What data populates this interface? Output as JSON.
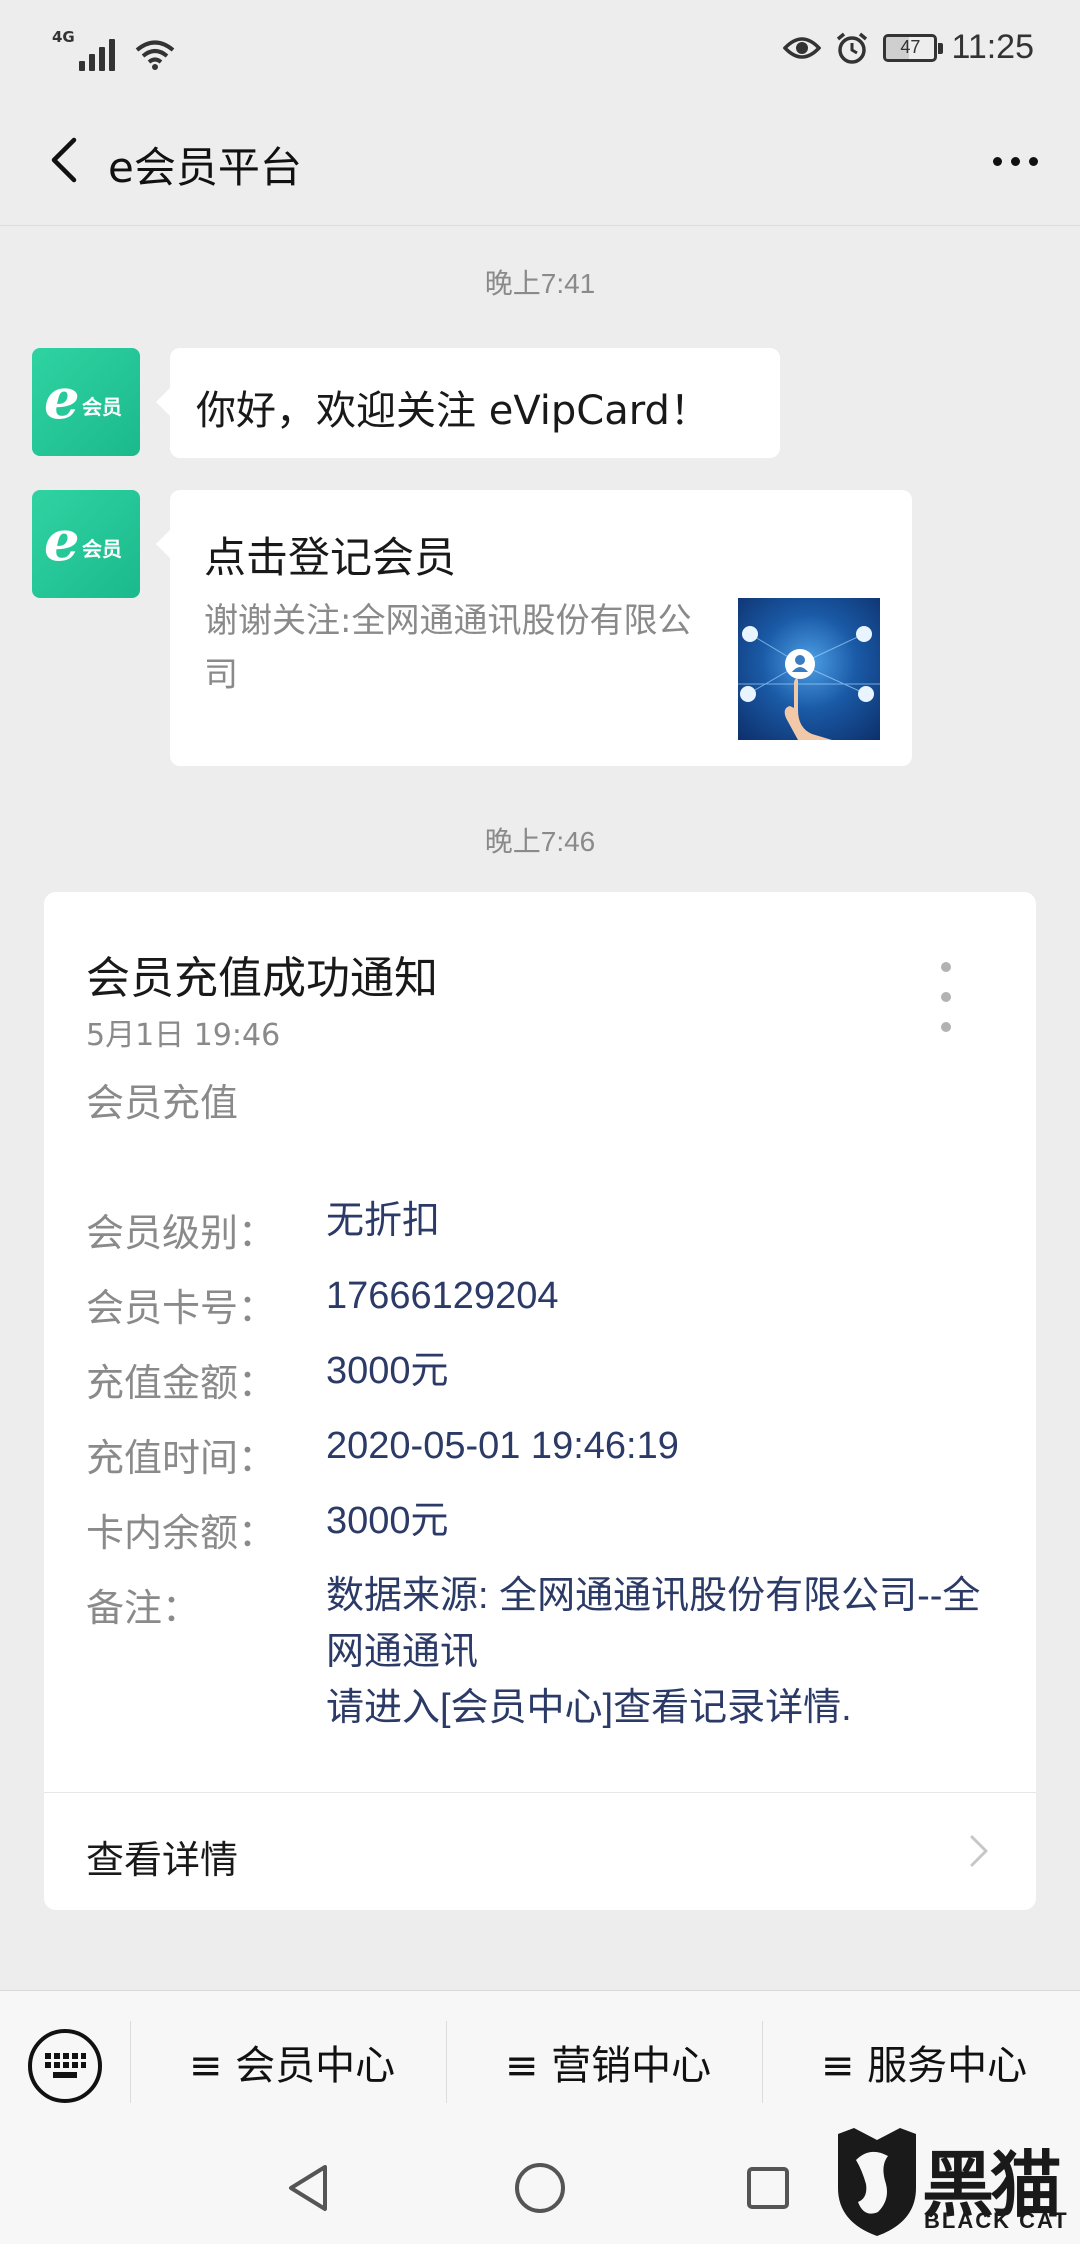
{
  "status_bar": {
    "network": "4G",
    "battery": "47",
    "time": "11:25"
  },
  "nav": {
    "title": "e会员平台"
  },
  "messages": [
    {
      "time": "晚上7:41"
    },
    {
      "avatar_text": "会员",
      "text": "你好，欢迎关注 eVipCard！"
    },
    {
      "avatar_text": "会员",
      "link_title": "点击登记会员",
      "link_desc": "谢谢关注:全网通通讯股份有限公司"
    },
    {
      "time": "晚上7:46"
    }
  ],
  "card": {
    "title": "会员充值成功通知",
    "date": "5月1日 19:46",
    "subtitle": "会员充值",
    "fields": [
      {
        "label": "会员级别：",
        "value": "无折扣"
      },
      {
        "label": "会员卡号：",
        "value": "17666129204"
      },
      {
        "label": "充值金额：",
        "value": "3000元"
      },
      {
        "label": "充值时间：",
        "value": "2020-05-01 19:46:19"
      },
      {
        "label": "卡内余额：",
        "value": "3000元"
      },
      {
        "label": "备注：",
        "value": "数据来源: 全网通通讯股份有限公司--全网通通讯\n请进入[会员中心]查看记录详情."
      }
    ],
    "footer_label": "查看详情"
  },
  "menu": {
    "items": [
      "≡ 会员中心",
      "≡ 营销中心",
      "≡ 服务中心"
    ]
  },
  "watermark": {
    "text": "黑猫",
    "sub": "BLACK CAT"
  }
}
